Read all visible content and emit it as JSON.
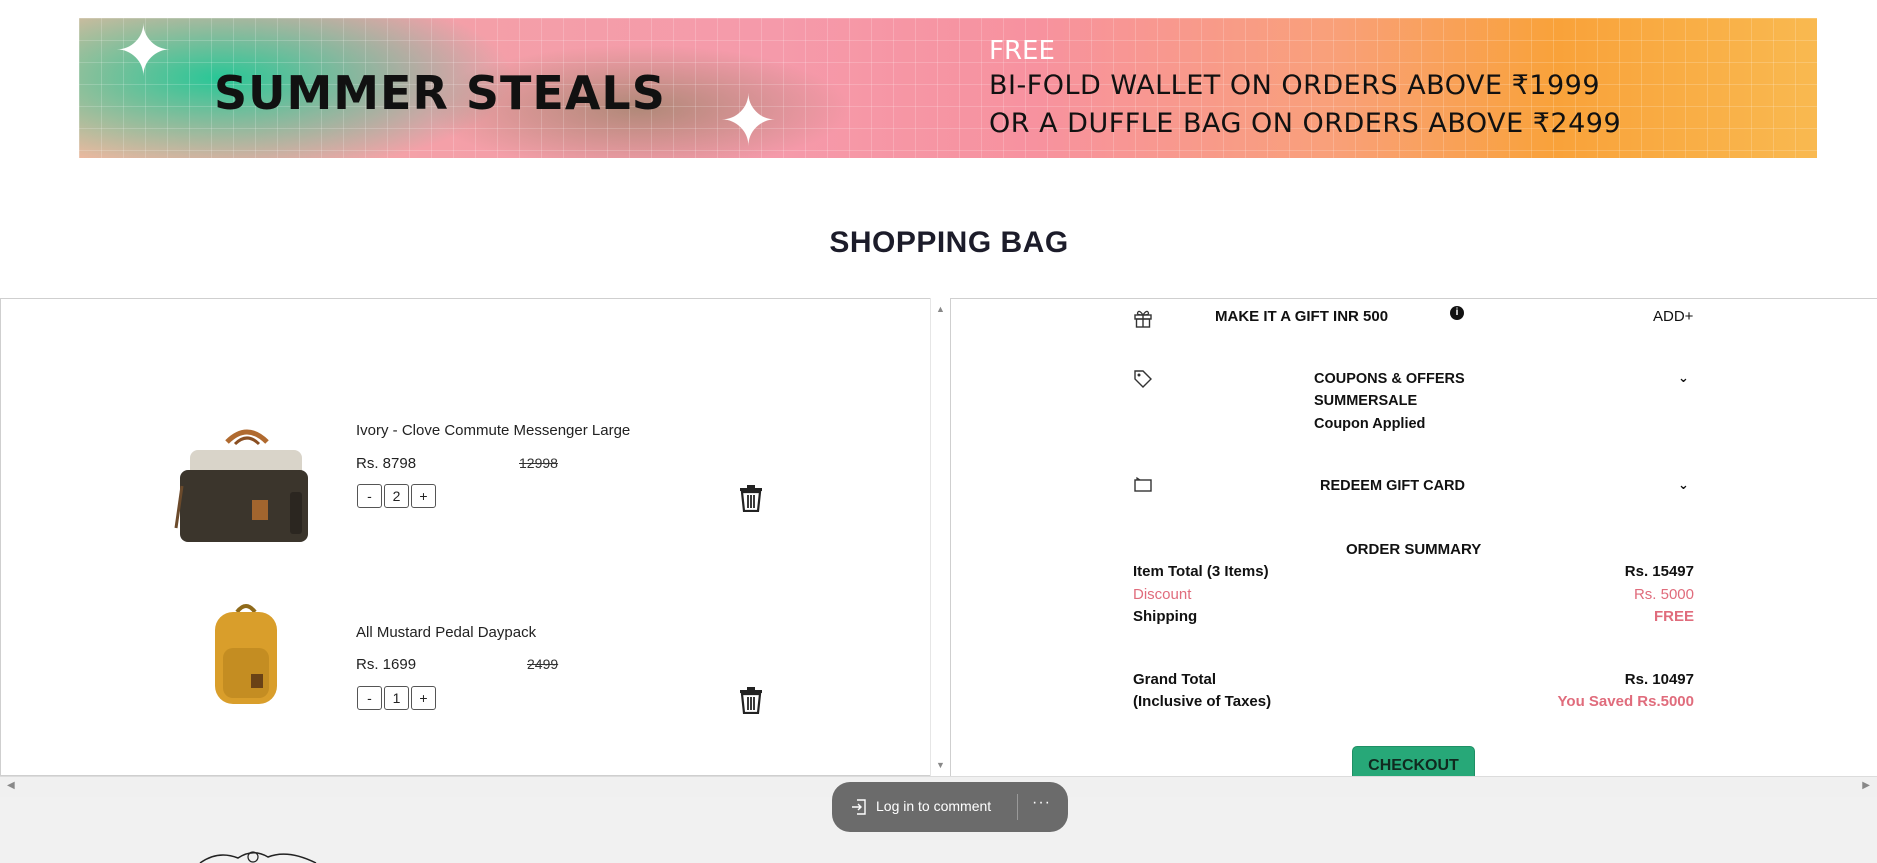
{
  "banner": {
    "title": "SUMMER STEALS",
    "free": "FREE",
    "line1": "BI-FOLD WALLET ON ORDERS ABOVE ₹1999",
    "line2": "OR A DUFFLE BAG ON ORDERS ABOVE ₹2499"
  },
  "page_title": "SHOPPING BAG",
  "cart": {
    "items": [
      {
        "name": "Ivory - Clove Commute Messenger Large",
        "price": "Rs. 8798",
        "mrp": "12998",
        "qty": "2",
        "minus": "-",
        "plus": "+"
      },
      {
        "name": "All Mustard Pedal Daypack",
        "price": "Rs. 1699",
        "mrp": "2499",
        "qty": "1",
        "minus": "-",
        "plus": "+"
      }
    ]
  },
  "summary": {
    "gift_label": "MAKE IT A GIFT INR 500",
    "gift_info": "i",
    "gift_add": "ADD+",
    "coupons_label": "COUPONS & OFFERS",
    "coupon_code": "SUMMERSALE",
    "coupon_status": "Coupon Applied",
    "redeem_label": "REDEEM GIFT CARD",
    "order_summary": "ORDER SUMMARY",
    "item_total_label": "Item Total (3 Items)",
    "item_total_value": "Rs. 15497",
    "discount_label": "Discount",
    "discount_value": "Rs. 5000",
    "shipping_label": "Shipping",
    "shipping_value": "FREE",
    "grand_total_label": "Grand Total",
    "taxes_label": "(Inclusive of Taxes)",
    "grand_total_value": "Rs. 10497",
    "saved_value": "You Saved Rs.5000",
    "checkout": "CHECKOUT"
  },
  "comment_bar": {
    "login_label": "Log in to comment",
    "more": "···"
  },
  "colors": {
    "accent_checkout": "#27a878",
    "discount_pink": "#e06c7c"
  }
}
